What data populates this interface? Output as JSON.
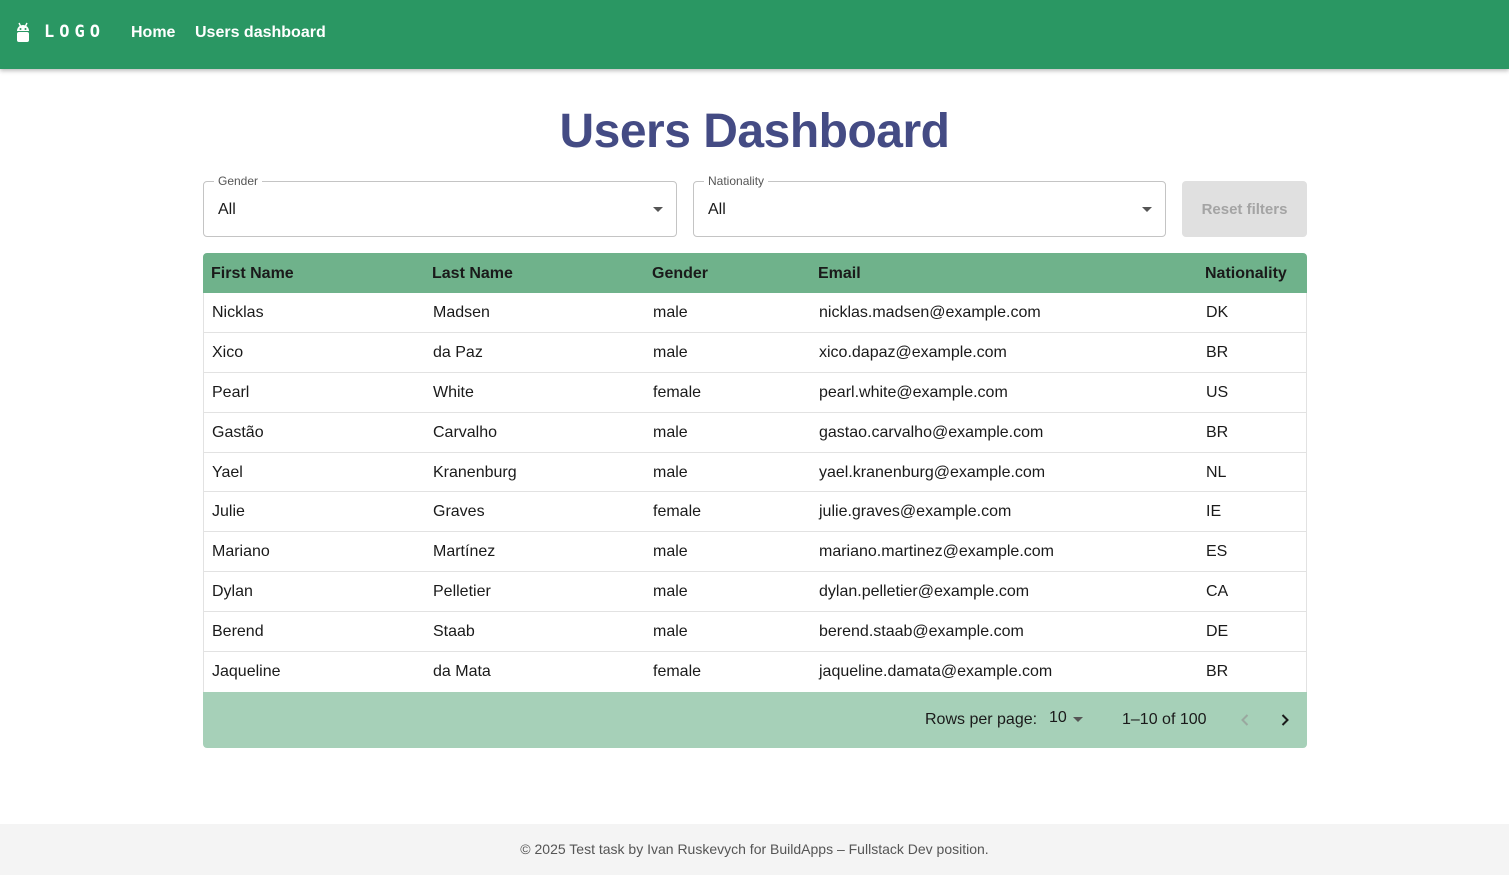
{
  "header": {
    "logo_text": "LOGO",
    "nav": [
      {
        "label": "Home"
      },
      {
        "label": "Users dashboard"
      }
    ]
  },
  "page_title": "Users Dashboard",
  "filters": {
    "gender": {
      "label": "Gender",
      "value": "All"
    },
    "nationality": {
      "label": "Nationality",
      "value": "All"
    },
    "reset_label": "Reset filters"
  },
  "table": {
    "columns": [
      "First Name",
      "Last Name",
      "Gender",
      "Email",
      "Nationality"
    ],
    "rows": [
      [
        "Nicklas",
        "Madsen",
        "male",
        "nicklas.madsen@example.com",
        "DK"
      ],
      [
        "Xico",
        "da Paz",
        "male",
        "xico.dapaz@example.com",
        "BR"
      ],
      [
        "Pearl",
        "White",
        "female",
        "pearl.white@example.com",
        "US"
      ],
      [
        "Gastão",
        "Carvalho",
        "male",
        "gastao.carvalho@example.com",
        "BR"
      ],
      [
        "Yael",
        "Kranenburg",
        "male",
        "yael.kranenburg@example.com",
        "NL"
      ],
      [
        "Julie",
        "Graves",
        "female",
        "julie.graves@example.com",
        "IE"
      ],
      [
        "Mariano",
        "Martínez",
        "male",
        "mariano.martinez@example.com",
        "ES"
      ],
      [
        "Dylan",
        "Pelletier",
        "male",
        "dylan.pelletier@example.com",
        "CA"
      ],
      [
        "Berend",
        "Staab",
        "male",
        "berend.staab@example.com",
        "DE"
      ],
      [
        "Jaqueline",
        "da Mata",
        "female",
        "jaqueline.damata@example.com",
        "BR"
      ]
    ]
  },
  "pagination": {
    "rows_per_page_label": "Rows per page:",
    "rows_per_page_value": "10",
    "range": "1–10 of 100"
  },
  "footer": {
    "text": "© 2025 Test task by Ivan Ruskevych for BuildApps – Fullstack Dev position."
  },
  "colors": {
    "appbar": "#2a9763",
    "title": "#444b84",
    "table_header": "#6fb28b",
    "pager_bg": "#a6d0b8"
  }
}
